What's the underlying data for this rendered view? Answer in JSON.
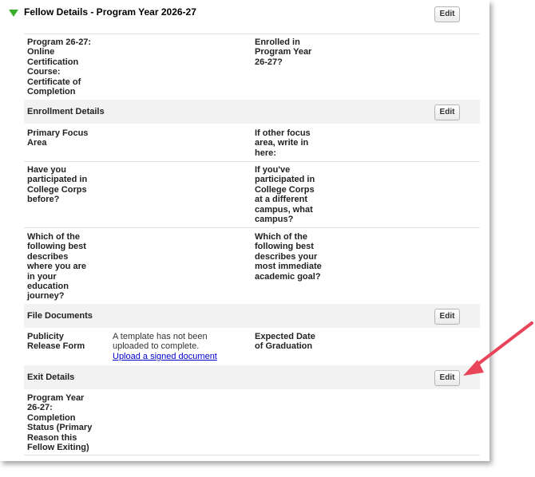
{
  "panel": {
    "title": "Fellow Details - Program Year 2026-27",
    "edit_label": "Edit"
  },
  "program": {
    "label_left": "Program 26-27:\nOnline\nCertification\nCourse:\nCertificate of\nCompletion",
    "label_right": "Enrolled in\nProgram Year\n26-27?"
  },
  "enrollment": {
    "title": "Enrollment Details",
    "edit_label": "Edit",
    "row1_left": "Primary Focus\nArea",
    "row1_right": "If other focus\narea, write in\nhere:",
    "row2_left": "Have you\nparticipated in\nCollege Corps\nbefore?",
    "row2_right": "If you've\nparticipated in\nCollege Corps\nat a different\ncampus, what\ncampus?",
    "row3_left": "Which of the\nfollowing best\ndescribes\nwhere you are\nin your\neducation\njourney?",
    "row3_right": "Which of the\nfollowing best\ndescribes your\nmost immediate\nacademic goal?"
  },
  "files": {
    "title": "File Documents",
    "edit_label": "Edit",
    "publicity_label": "Publicity\nRelease Form",
    "template_text": "A template has not been\nuploaded to complete.",
    "upload_link": "Upload a signed document",
    "graduation_label": "Expected Date\nof Graduation"
  },
  "exit": {
    "title": "Exit Details",
    "edit_label": "Edit",
    "completion_label": "Program Year\n26-27:\nCompletion\nStatus (Primary\nReason this\nFellow Exiting)"
  },
  "annotation_color": "#e8455a"
}
